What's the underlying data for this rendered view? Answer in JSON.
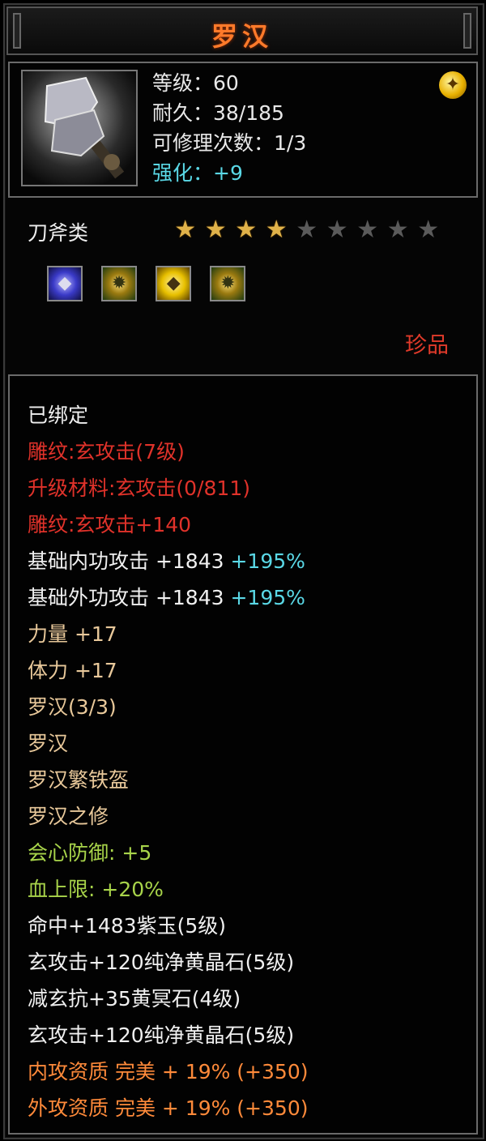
{
  "item": {
    "name": "罗汉",
    "stats": [
      {
        "label": "等级：60",
        "color": "#e8e8e8"
      },
      {
        "label": "耐久：38/185",
        "color": "#e8e8e8"
      },
      {
        "label": "可修理次数：1/3",
        "color": "#e8e8e8"
      },
      {
        "label": "强化：+9",
        "color": "#5ad8e6"
      }
    ],
    "category": "刀斧类",
    "stars": {
      "filled": 4,
      "total": 9
    },
    "gem_slots": [
      "blue-gem-icon",
      "yellow-crystal-icon",
      "gold-gem-icon",
      "yellow-crystal-icon"
    ],
    "rarity": "珍品"
  },
  "attributes": [
    [
      {
        "t": "已绑定",
        "c": "white"
      }
    ],
    [
      {
        "t": "雕纹:玄攻击(7级)",
        "c": "red"
      }
    ],
    [
      {
        "t": "升级材料:玄攻击(0/811)",
        "c": "red"
      }
    ],
    [
      {
        "t": "雕纹:玄攻击+140",
        "c": "red"
      }
    ],
    [
      {
        "t": "基础内功攻击  +1843 ",
        "c": "white"
      },
      {
        "t": "+195%",
        "c": "cyan"
      }
    ],
    [
      {
        "t": "基础外功攻击  +1843 ",
        "c": "white"
      },
      {
        "t": "+195%",
        "c": "cyan"
      }
    ],
    [
      {
        "t": "力量  +17",
        "c": "sand"
      }
    ],
    [
      {
        "t": "体力  +17",
        "c": "sand"
      }
    ],
    [
      {
        "t": "罗汉(3/3)",
        "c": "sand"
      }
    ],
    [
      {
        "t": "罗汉",
        "c": "sand"
      }
    ],
    [
      {
        "t": "罗汉繁铁盔",
        "c": "sand"
      }
    ],
    [
      {
        "t": "罗汉之修",
        "c": "sand"
      }
    ],
    [
      {
        "t": "会心防御: +5",
        "c": "green"
      }
    ],
    [
      {
        "t": "血上限: +20%",
        "c": "green"
      }
    ],
    [
      {
        "t": "命中+1483紫玉(5级)",
        "c": "white"
      }
    ],
    [
      {
        "t": "玄攻击+120纯净黄晶石(5级)",
        "c": "white"
      }
    ],
    [
      {
        "t": "减玄抗+35黄冥石(4级)",
        "c": "white"
      }
    ],
    [
      {
        "t": "玄攻击+120纯净黄晶石(5级)",
        "c": "white"
      }
    ],
    [
      {
        "t": "内攻资质  完美  +  19% (+350)",
        "c": "orange"
      }
    ],
    [
      {
        "t": "外攻资质  完美  +  19% (+350)",
        "c": "orange"
      }
    ]
  ]
}
